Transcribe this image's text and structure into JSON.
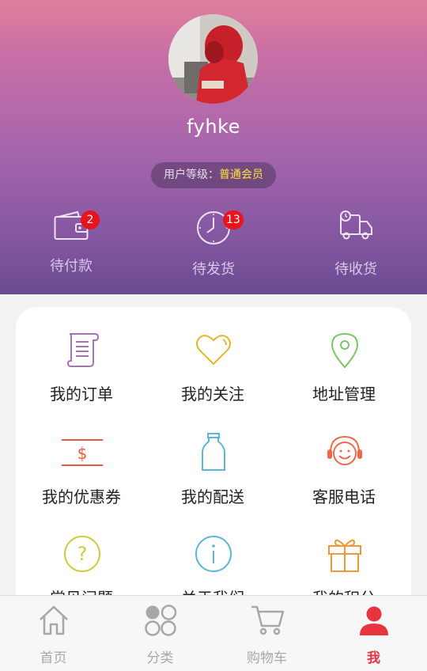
{
  "user": {
    "name": "fyhke",
    "level_label": "用户等级：",
    "level_value": "普通会员"
  },
  "orders": [
    {
      "label": "待付款",
      "badge": "2",
      "icon": "wallet-icon"
    },
    {
      "label": "待发货",
      "badge": "13",
      "icon": "clock-icon"
    },
    {
      "label": "待收货",
      "badge": "",
      "icon": "truck-icon"
    }
  ],
  "menu": [
    {
      "label": "我的订单",
      "icon": "order-scroll-icon"
    },
    {
      "label": "我的关注",
      "icon": "heart-icon"
    },
    {
      "label": "地址管理",
      "icon": "location-pin-icon"
    },
    {
      "label": "我的优惠券",
      "icon": "coupon-icon"
    },
    {
      "label": "我的配送",
      "icon": "bottle-icon"
    },
    {
      "label": "客服电话",
      "icon": "headset-icon"
    },
    {
      "label": "常见问题",
      "icon": "question-icon"
    },
    {
      "label": "关于我们",
      "icon": "info-icon"
    },
    {
      "label": "我的积分",
      "icon": "gift-icon"
    }
  ],
  "tabs": [
    {
      "label": "首页",
      "icon": "home-icon"
    },
    {
      "label": "分类",
      "icon": "category-icon"
    },
    {
      "label": "购物车",
      "icon": "cart-icon"
    },
    {
      "label": "我",
      "icon": "user-icon"
    }
  ],
  "colors": {
    "accent": "#e8343e",
    "badge": "#e8141b",
    "level_value": "#ffe23a"
  }
}
